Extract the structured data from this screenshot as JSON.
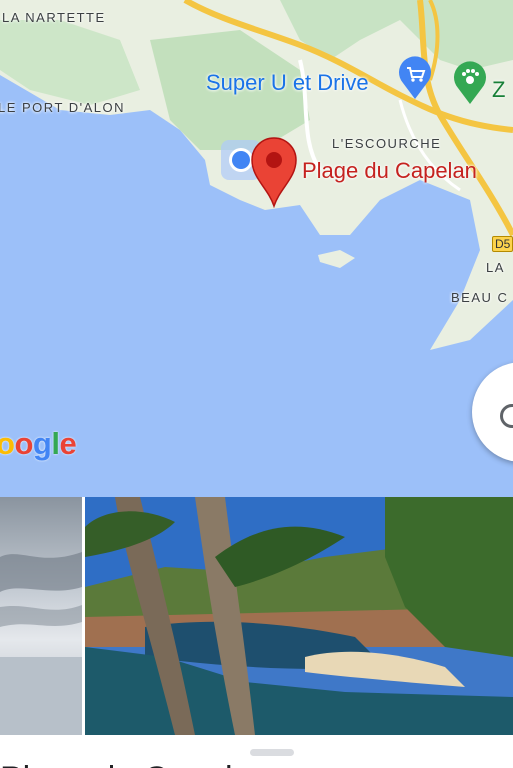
{
  "map": {
    "labels": {
      "la_nartette": "LA NARTETTE",
      "le_port_d_alon": "LE PORT D'ALON",
      "l_escourche": "L'ESCOURCHE",
      "la": "LA",
      "beau": "BEAU C",
      "road": "D5"
    },
    "pois": {
      "super_u": "Super U et Drive",
      "zoo_partial": "Z",
      "selected_place": "Plage du Capelan"
    },
    "logo": "Google"
  },
  "photos": [
    {
      "subject": "cloudy sea horizon"
    },
    {
      "subject": "pine trees over a cove with a sandy beach"
    }
  ],
  "sheet": {
    "title": "Plage du Capelan"
  },
  "colors": {
    "water": "#9cc0f9",
    "land": "#e8f1de",
    "park": "#c6e4c2",
    "road": "#f6c64a",
    "pin": "#ea4335",
    "location_dot": "#4285f4"
  }
}
